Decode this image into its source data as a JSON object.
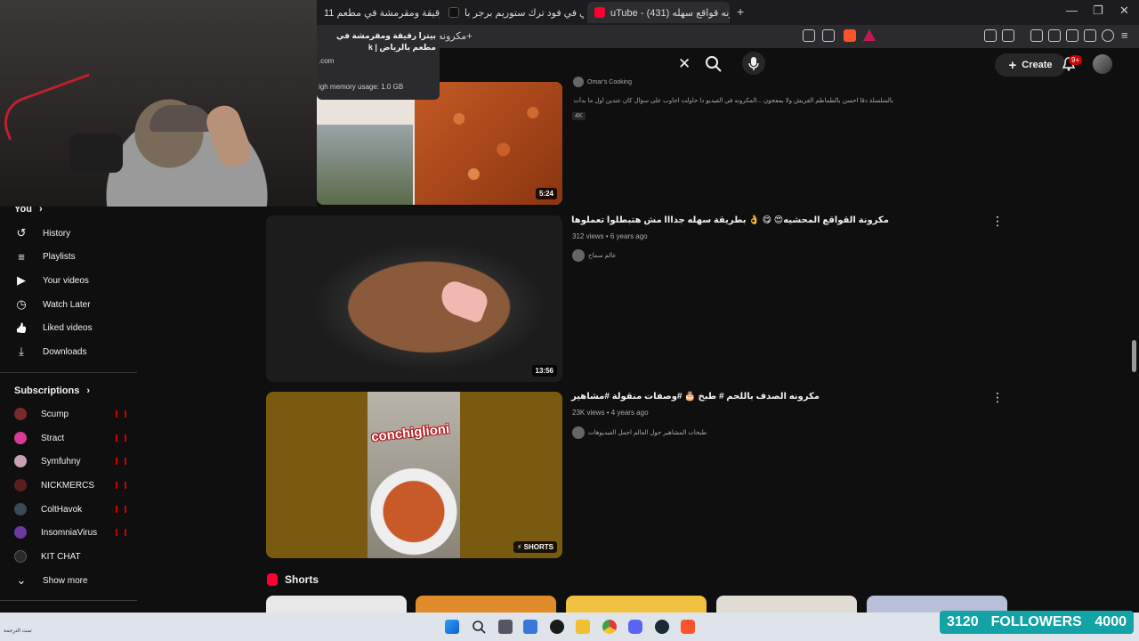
{
  "browser": {
    "tabs": [
      {
        "label": "بيتزا رقيقة ومقرمشة في مطعم 11",
        "active": false
      },
      {
        "label": "برجر فضائي في فود ترك ستوريم برجر با",
        "active": false
      },
      {
        "label": "uTube - مكرونه قواقع سهله (431)",
        "active": true
      }
    ],
    "new_tab": "+",
    "url": "مكرونه+",
    "window_controls": [
      "—",
      "❐",
      "✕"
    ]
  },
  "tab_popup": {
    "title": "بيتزا رقيقة ومقرمشة في مطعم بالرياض | k",
    "site": ".com",
    "memory": "igh memory usage: 1.0 GB"
  },
  "header": {
    "clear": "✕",
    "create_label": "Create",
    "notifications_badge": "9+"
  },
  "sidebar": {
    "you_label": "You",
    "you_items": [
      {
        "label": "History",
        "icon": "history-icon",
        "glyph": "↺"
      },
      {
        "label": "Playlists",
        "icon": "playlists-icon",
        "glyph": "≡"
      },
      {
        "label": "Your videos",
        "icon": "your-videos-icon",
        "glyph": "▶"
      },
      {
        "label": "Watch Later",
        "icon": "watch-later-icon",
        "glyph": "◷"
      },
      {
        "label": "Liked videos",
        "icon": "thumbs-up-icon",
        "glyph": "👍"
      },
      {
        "label": "Downloads",
        "icon": "download-icon",
        "glyph": "⤓"
      }
    ],
    "subscriptions_label": "Subscriptions",
    "subscriptions": [
      {
        "label": "Scump",
        "color": "#7a2a2a",
        "live": true
      },
      {
        "label": "Stract",
        "color": "#d93a9a",
        "live": true
      },
      {
        "label": "Symfuhny",
        "color": "#c9a0b4",
        "live": true
      },
      {
        "label": "NICKMERCS",
        "color": "#5a2020",
        "live": true
      },
      {
        "label": "ColtHavok",
        "color": "#3a4a5a",
        "live": true
      },
      {
        "label": "InsomniaVirus",
        "color": "#6a3aa0",
        "live": true
      },
      {
        "label": "KIT CHAT",
        "color": "#2a2a2a",
        "live": false
      }
    ],
    "show_more": "Show more"
  },
  "videos": [
    {
      "title": "",
      "channel": "Omar's Cooking",
      "description": "بالسلسلة دقا احسن بالطماطم القريش ولا بمعجون ...المكرونه في الفيديو دا حاولت اجاوب على سؤال كان عندين اول ما بدأت اطبخ، وهو هل",
      "badge": "4K",
      "duration": "5:24"
    },
    {
      "title": "مكرونة القواقع المحشيه😍 😋 👌 بطريقة سهله جدااا مش هتبطلوا تعملوها",
      "views": "312 views",
      "age": "6 years ago",
      "channel": "عالم سماح",
      "duration": "13:56"
    },
    {
      "title": "مكرونه الصدف باللحم # طبخ 🎂 #وصفات منقولة #مشاهير",
      "views": "23K views",
      "age": "4 years ago",
      "channel": "طبخات المشاهير حول العالم اجمل الفيديوهات",
      "overlay_text": "conchiglioni",
      "duration": "SHORTS"
    }
  ],
  "shorts_label": "Shorts",
  "taskbar": {
    "left_text": "ﺗﻤﺖ ﺍﻟﺘﺮﺟﻤﺔ",
    "followers_count": "3120",
    "followers_label": "FOLLOWERS",
    "followers_goal": "4000"
  }
}
